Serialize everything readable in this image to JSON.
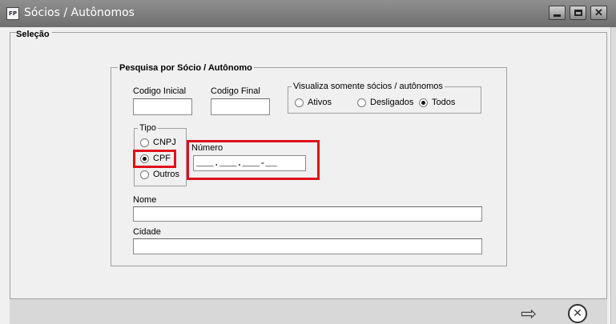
{
  "window": {
    "icon_text": "FP",
    "title": "Sócios / Autônomos"
  },
  "panel": {
    "legend": "Seleção"
  },
  "search": {
    "legend": "Pesquisa por Sócio / Autônomo",
    "codigo_inicial": {
      "label": "Codigo Inicial",
      "value": ""
    },
    "codigo_final": {
      "label": "Codigo Final",
      "value": ""
    },
    "visualiza": {
      "legend": "Visualiza somente sócios / autônomos",
      "options": [
        "Ativos",
        "Desligados",
        "Todos"
      ],
      "selected": "Todos"
    },
    "tipo": {
      "legend": "Tipo",
      "options": [
        "CNPJ",
        "CPF",
        "Outros"
      ],
      "selected": "CPF"
    },
    "numero": {
      "label": "Número",
      "mask": "___.___.___-__"
    },
    "nome": {
      "label": "Nome",
      "value": ""
    },
    "cidade": {
      "label": "Cidade",
      "value": ""
    }
  },
  "footer": {
    "next_icon": "arrow-right-icon",
    "cancel_icon": "close-circle-icon"
  },
  "colors": {
    "highlight": "#e0101a",
    "titlebar": "#7a7a7a"
  }
}
